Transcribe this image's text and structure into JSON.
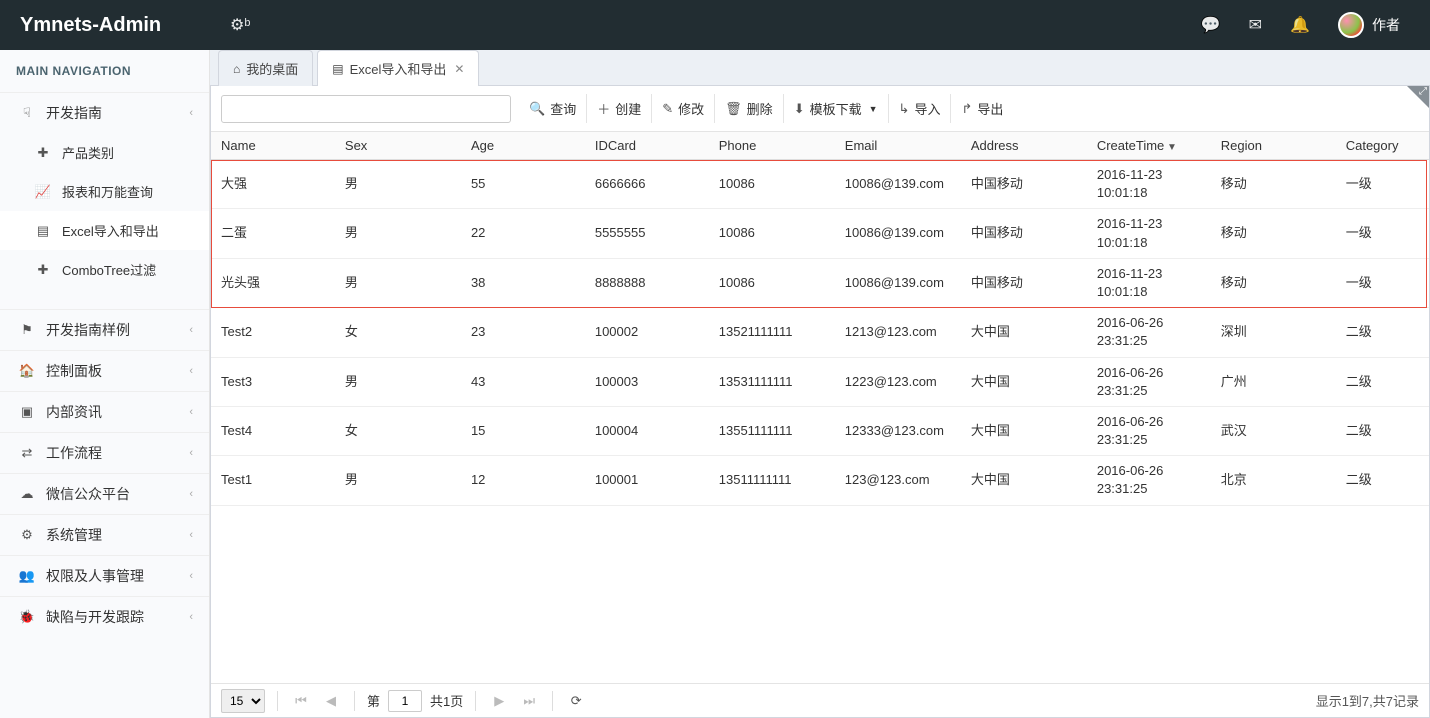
{
  "app": {
    "title": "Ymnets-Admin"
  },
  "topbar": {
    "user_label": "作者"
  },
  "sidebar": {
    "header": "MAIN NAVIGATION",
    "dev_guide": "开发指南",
    "sub": {
      "product_category": "产品类别",
      "report_query": "报表和万能查询",
      "excel_io": "Excel导入和导出",
      "combotree": "ComboTree过滤"
    },
    "groups": {
      "dev_guide_examples": "开发指南样例",
      "dashboard": "控制面板",
      "internal_news": "内部资讯",
      "workflow": "工作流程",
      "wechat": "微信公众平台",
      "sys_mgmt": "系统管理",
      "perm_hr": "权限及人事管理",
      "bugs_dev": "缺陷与开发跟踪"
    }
  },
  "tabs": {
    "desktop": "我的桌面",
    "active": "Excel导入和导出"
  },
  "toolbar": {
    "search_placeholder": "",
    "query": "查询",
    "create": "创建",
    "edit": "修改",
    "delete": "删除",
    "template_download": "模板下载",
    "import": "导入",
    "export": "导出"
  },
  "table": {
    "headers": {
      "name": "Name",
      "sex": "Sex",
      "age": "Age",
      "idcard": "IDCard",
      "phone": "Phone",
      "email": "Email",
      "address": "Address",
      "createtime": "CreateTime",
      "region": "Region",
      "category": "Category"
    },
    "rows": [
      {
        "name": "大强",
        "sex": "男",
        "age": "55",
        "idcard": "6666666",
        "phone": "10086",
        "email": "10086@139.com",
        "address": "中国移动",
        "createtime": "2016-11-23 10:01:18",
        "region": "移动",
        "category": "一级",
        "hl": true
      },
      {
        "name": "二蛋",
        "sex": "男",
        "age": "22",
        "idcard": "5555555",
        "phone": "10086",
        "email": "10086@139.com",
        "address": "中国移动",
        "createtime": "2016-11-23 10:01:18",
        "region": "移动",
        "category": "一级",
        "hl": true
      },
      {
        "name": "光头强",
        "sex": "男",
        "age": "38",
        "idcard": "8888888",
        "phone": "10086",
        "email": "10086@139.com",
        "address": "中国移动",
        "createtime": "2016-11-23 10:01:18",
        "region": "移动",
        "category": "一级",
        "hl": true
      },
      {
        "name": "Test2",
        "sex": "女",
        "age": "23",
        "idcard": "100002",
        "phone": "13521111111",
        "email": "1213@123.com",
        "address": "大中国",
        "createtime": "2016-06-26 23:31:25",
        "region": "深圳",
        "category": "二级"
      },
      {
        "name": "Test3",
        "sex": "男",
        "age": "43",
        "idcard": "100003",
        "phone": "13531111111",
        "email": "1223@123.com",
        "address": "大中国",
        "createtime": "2016-06-26 23:31:25",
        "region": "广州",
        "category": "二级"
      },
      {
        "name": "Test4",
        "sex": "女",
        "age": "15",
        "idcard": "100004",
        "phone": "13551111111",
        "email": "12333@123.com",
        "address": "大中国",
        "createtime": "2016-06-26 23:31:25",
        "region": "武汉",
        "category": "二级"
      },
      {
        "name": "Test1",
        "sex": "男",
        "age": "12",
        "idcard": "100001",
        "phone": "13511111111",
        "email": "123@123.com",
        "address": "大中国",
        "createtime": "2016-06-26 23:31:25",
        "region": "北京",
        "category": "二级"
      }
    ]
  },
  "pager": {
    "page_size": "15",
    "page_prefix": "第",
    "page_value": "1",
    "page_total": "共1页",
    "info": "显示1到7,共7记录"
  }
}
